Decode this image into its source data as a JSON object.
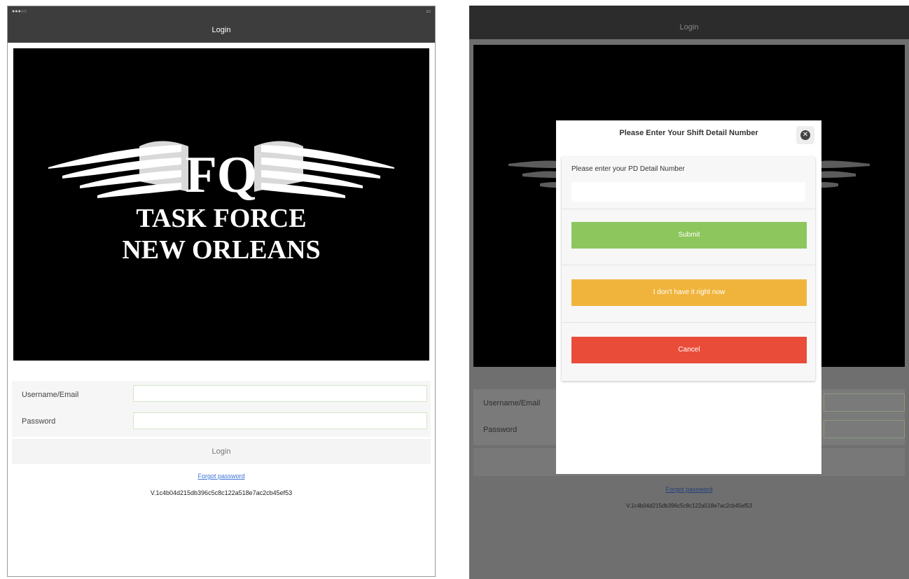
{
  "left_screen": {
    "nav_title": "Login",
    "logo_text": {
      "letters": "FQ",
      "line1": "TASK FORCE",
      "line2": "NEW ORLEANS"
    },
    "form": {
      "username_label": "Username/Email",
      "password_label": "Password"
    },
    "login_label": "Login",
    "forgot_label": "Forgot password",
    "version": "V.1c4b04d215db396c5c8c122a518e7ac2cb45ef53"
  },
  "right_screen": {
    "nav_title": "Login",
    "form": {
      "username_label": "Username/Email",
      "password_label": "Password"
    },
    "forgot_label": "Forgot password",
    "version": "V.1c4b04d215db396c5c8c122a518e7ac2cb45ef53",
    "modal": {
      "title": "Please Enter Your Shift Detail Number",
      "prompt": "Please enter your PD Detail Number",
      "close_icon": "close-icon",
      "buttons": {
        "submit": "Submit",
        "later": "I don't have it right now",
        "cancel": "Cancel"
      }
    }
  },
  "colors": {
    "submit": "#8cc65d",
    "later": "#f0b43d",
    "cancel": "#ea4c3a",
    "nav_bar": "#3d3d3d",
    "link": "#3a74d6"
  }
}
